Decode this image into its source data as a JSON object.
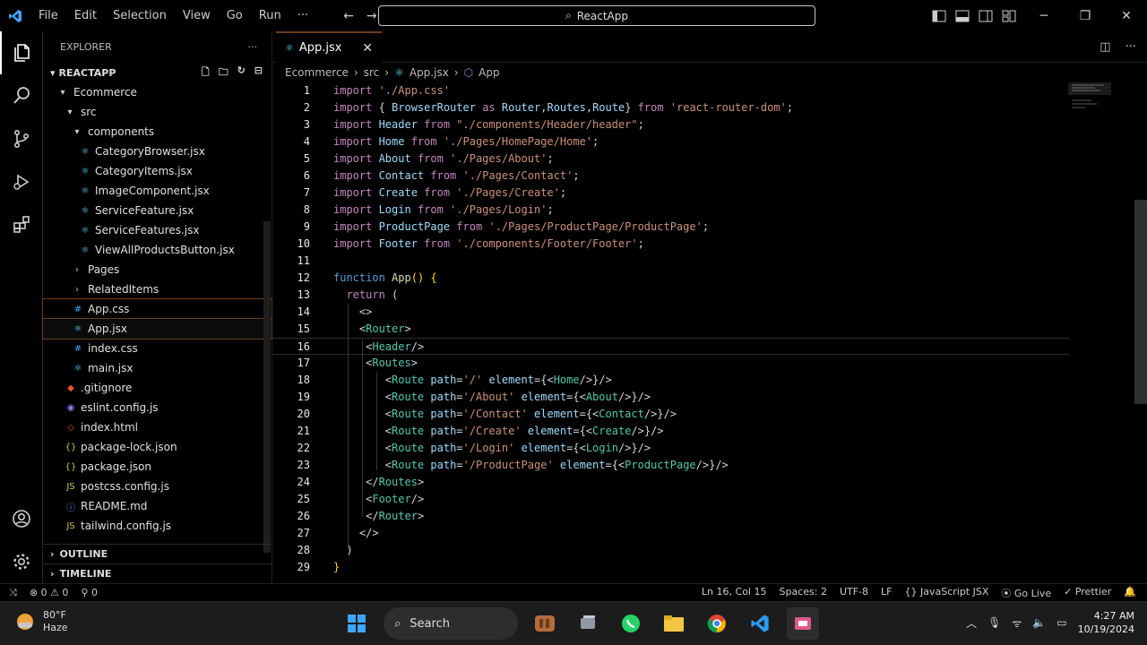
{
  "menu": [
    "File",
    "Edit",
    "Selection",
    "View",
    "Go",
    "Run",
    "···"
  ],
  "command_center": "ReactApp",
  "explorer": {
    "title": "EXPLORER",
    "root": "REACTAPP",
    "tree": [
      {
        "label": "Ecommerce",
        "type": "folder-open",
        "depth": 1
      },
      {
        "label": "src",
        "type": "folder-open",
        "depth": 2
      },
      {
        "label": "components",
        "type": "folder-open",
        "depth": 3
      },
      {
        "label": "CategoryBrowser.jsx",
        "type": "jsx",
        "depth": 4
      },
      {
        "label": "CategoryItems.jsx",
        "type": "jsx",
        "depth": 4
      },
      {
        "label": "ImageComponent.jsx",
        "type": "jsx",
        "depth": 4
      },
      {
        "label": "ServiceFeature.jsx",
        "type": "jsx",
        "depth": 4
      },
      {
        "label": "ServiceFeatures.jsx",
        "type": "jsx",
        "depth": 4
      },
      {
        "label": "ViewAllProductsButton.jsx",
        "type": "jsx",
        "depth": 4
      },
      {
        "label": "Pages",
        "type": "folder",
        "depth": 3
      },
      {
        "label": "RelatedItems",
        "type": "folder",
        "depth": 3
      },
      {
        "label": "App.css",
        "type": "css",
        "depth": 3,
        "state": "hover"
      },
      {
        "label": "App.jsx",
        "type": "jsx",
        "depth": 3,
        "state": "selected"
      },
      {
        "label": "index.css",
        "type": "css",
        "depth": 3
      },
      {
        "label": "main.jsx",
        "type": "jsx",
        "depth": 3
      },
      {
        "label": ".gitignore",
        "type": "git",
        "depth": 2
      },
      {
        "label": "eslint.config.js",
        "type": "eslint",
        "depth": 2
      },
      {
        "label": "index.html",
        "type": "html",
        "depth": 2
      },
      {
        "label": "package-lock.json",
        "type": "json",
        "depth": 2
      },
      {
        "label": "package.json",
        "type": "json",
        "depth": 2
      },
      {
        "label": "postcss.config.js",
        "type": "js",
        "depth": 2
      },
      {
        "label": "README.md",
        "type": "md",
        "depth": 2
      },
      {
        "label": "tailwind.config.js",
        "type": "js",
        "depth": 2
      }
    ],
    "outline": "OUTLINE",
    "timeline": "TIMELINE"
  },
  "tab": {
    "label": "App.jsx",
    "close": "✕"
  },
  "breadcrumb": [
    "Ecommerce",
    "src",
    "App.jsx",
    "App"
  ],
  "code_lines": [
    [
      [
        "kw",
        "import "
      ],
      [
        "str",
        "'./App.css'"
      ]
    ],
    [
      [
        "kw",
        "import "
      ],
      [
        "pun",
        "{ "
      ],
      [
        "id",
        "BrowserRouter "
      ],
      [
        "kw",
        "as "
      ],
      [
        "id",
        "Router"
      ],
      [
        "pun",
        ","
      ],
      [
        "id",
        "Routes"
      ],
      [
        "pun",
        ","
      ],
      [
        "id",
        "Route"
      ],
      [
        "pun",
        "} "
      ],
      [
        "kw",
        "from "
      ],
      [
        "str",
        "'react-router-dom'"
      ],
      [
        "pun",
        ";"
      ]
    ],
    [
      [
        "kw",
        "import "
      ],
      [
        "id",
        "Header "
      ],
      [
        "kw",
        "from "
      ],
      [
        "str",
        "\"./components/Header/header\""
      ],
      [
        "pun",
        ";"
      ]
    ],
    [
      [
        "kw",
        "import "
      ],
      [
        "id",
        "Home "
      ],
      [
        "kw",
        "from "
      ],
      [
        "str",
        "'./Pages/HomePage/Home'"
      ],
      [
        "pun",
        ";"
      ]
    ],
    [
      [
        "kw",
        "import "
      ],
      [
        "id",
        "About "
      ],
      [
        "kw",
        "from "
      ],
      [
        "str",
        "'./Pages/About'"
      ],
      [
        "pun",
        ";"
      ]
    ],
    [
      [
        "kw",
        "import "
      ],
      [
        "id",
        "Contact "
      ],
      [
        "kw",
        "from "
      ],
      [
        "str",
        "'./Pages/Contact'"
      ],
      [
        "pun",
        ";"
      ]
    ],
    [
      [
        "kw",
        "import "
      ],
      [
        "id",
        "Create "
      ],
      [
        "kw",
        "from "
      ],
      [
        "str",
        "'./Pages/Create'"
      ],
      [
        "pun",
        ";"
      ]
    ],
    [
      [
        "kw",
        "import "
      ],
      [
        "id",
        "Login "
      ],
      [
        "kw",
        "from "
      ],
      [
        "str",
        "'./Pages/Login'"
      ],
      [
        "pun",
        ";"
      ]
    ],
    [
      [
        "kw",
        "import "
      ],
      [
        "id",
        "ProductPage "
      ],
      [
        "kw",
        "from "
      ],
      [
        "str",
        "'./Pages/ProductPage/ProductPage'"
      ],
      [
        "pun",
        ";"
      ]
    ],
    [
      [
        "kw",
        "import "
      ],
      [
        "id",
        "Footer "
      ],
      [
        "kw",
        "from "
      ],
      [
        "str",
        "'./components/Footer/Footer'"
      ],
      [
        "pun",
        ";"
      ]
    ],
    [],
    [
      [
        "kw2",
        "function "
      ],
      [
        "fn",
        "App"
      ],
      [
        "brk",
        "() {"
      ]
    ],
    [
      [
        "plain",
        "  "
      ],
      [
        "kw",
        "return "
      ],
      [
        "pun",
        "("
      ]
    ],
    [
      [
        "plain",
        "    "
      ],
      [
        "pun",
        "<>"
      ]
    ],
    [
      [
        "plain",
        "    "
      ],
      [
        "pun",
        "<"
      ],
      [
        "tag",
        "Router"
      ],
      [
        "pun",
        ">"
      ]
    ],
    [
      [
        "plain",
        "     "
      ],
      [
        "pun",
        "<"
      ],
      [
        "tag",
        "Header"
      ],
      [
        "pun",
        "/>"
      ]
    ],
    [
      [
        "plain",
        "     "
      ],
      [
        "pun",
        "<"
      ],
      [
        "tag",
        "Routes"
      ],
      [
        "pun",
        ">"
      ]
    ],
    [
      [
        "plain",
        "        "
      ],
      [
        "pun",
        "<"
      ],
      [
        "tag",
        "Route "
      ],
      [
        "id",
        "path"
      ],
      [
        "pun",
        "="
      ],
      [
        "str",
        "'/' "
      ],
      [
        "id",
        "element"
      ],
      [
        "pun",
        "={<"
      ],
      [
        "tag",
        "Home"
      ],
      [
        "pun",
        "/>}/>"
      ]
    ],
    [
      [
        "plain",
        "        "
      ],
      [
        "pun",
        "<"
      ],
      [
        "tag",
        "Route "
      ],
      [
        "id",
        "path"
      ],
      [
        "pun",
        "="
      ],
      [
        "str",
        "'/About' "
      ],
      [
        "id",
        "element"
      ],
      [
        "pun",
        "={<"
      ],
      [
        "tag",
        "About"
      ],
      [
        "pun",
        "/>}/>"
      ]
    ],
    [
      [
        "plain",
        "        "
      ],
      [
        "pun",
        "<"
      ],
      [
        "tag",
        "Route "
      ],
      [
        "id",
        "path"
      ],
      [
        "pun",
        "="
      ],
      [
        "str",
        "'/Contact' "
      ],
      [
        "id",
        "element"
      ],
      [
        "pun",
        "={<"
      ],
      [
        "tag",
        "Contact"
      ],
      [
        "pun",
        "/>}/>"
      ]
    ],
    [
      [
        "plain",
        "        "
      ],
      [
        "pun",
        "<"
      ],
      [
        "tag",
        "Route "
      ],
      [
        "id",
        "path"
      ],
      [
        "pun",
        "="
      ],
      [
        "str",
        "'/Create' "
      ],
      [
        "id",
        "element"
      ],
      [
        "pun",
        "={<"
      ],
      [
        "tag",
        "Create"
      ],
      [
        "pun",
        "/>}/>"
      ]
    ],
    [
      [
        "plain",
        "        "
      ],
      [
        "pun",
        "<"
      ],
      [
        "tag",
        "Route "
      ],
      [
        "id",
        "path"
      ],
      [
        "pun",
        "="
      ],
      [
        "str",
        "'/Login' "
      ],
      [
        "id",
        "element"
      ],
      [
        "pun",
        "={<"
      ],
      [
        "tag",
        "Login"
      ],
      [
        "pun",
        "/>}/>"
      ]
    ],
    [
      [
        "plain",
        "        "
      ],
      [
        "pun",
        "<"
      ],
      [
        "tag",
        "Route "
      ],
      [
        "id",
        "path"
      ],
      [
        "pun",
        "="
      ],
      [
        "str",
        "'/ProductPage' "
      ],
      [
        "id",
        "element"
      ],
      [
        "pun",
        "={<"
      ],
      [
        "tag",
        "ProductPage"
      ],
      [
        "pun",
        "/>}/>"
      ]
    ],
    [
      [
        "plain",
        "     "
      ],
      [
        "pun",
        "</"
      ],
      [
        "tag",
        "Routes"
      ],
      [
        "pun",
        ">"
      ]
    ],
    [
      [
        "plain",
        "     "
      ],
      [
        "pun",
        "<"
      ],
      [
        "tag",
        "Footer"
      ],
      [
        "pun",
        "/>"
      ]
    ],
    [
      [
        "plain",
        "     "
      ],
      [
        "pun",
        "</"
      ],
      [
        "tag",
        "Router"
      ],
      [
        "pun",
        ">"
      ]
    ],
    [
      [
        "plain",
        "    "
      ],
      [
        "pun",
        "</>"
      ]
    ],
    [
      [
        "plain",
        "  "
      ],
      [
        "pun",
        ")"
      ]
    ],
    [
      [
        "brk",
        "}"
      ]
    ]
  ],
  "current_line": 16,
  "status": {
    "errors": "0",
    "warnings": "0",
    "ports": "0",
    "position": "Ln 16, Col 15",
    "spaces": "Spaces: 2",
    "encoding": "UTF-8",
    "eol": "LF",
    "language": "JavaScript JSX",
    "golive": "Go Live",
    "prettier": "Prettier"
  },
  "taskbar": {
    "temp": "80°F",
    "weather": "Haze",
    "search": "Search",
    "time": "4:27 AM",
    "date": "10/19/2024"
  }
}
